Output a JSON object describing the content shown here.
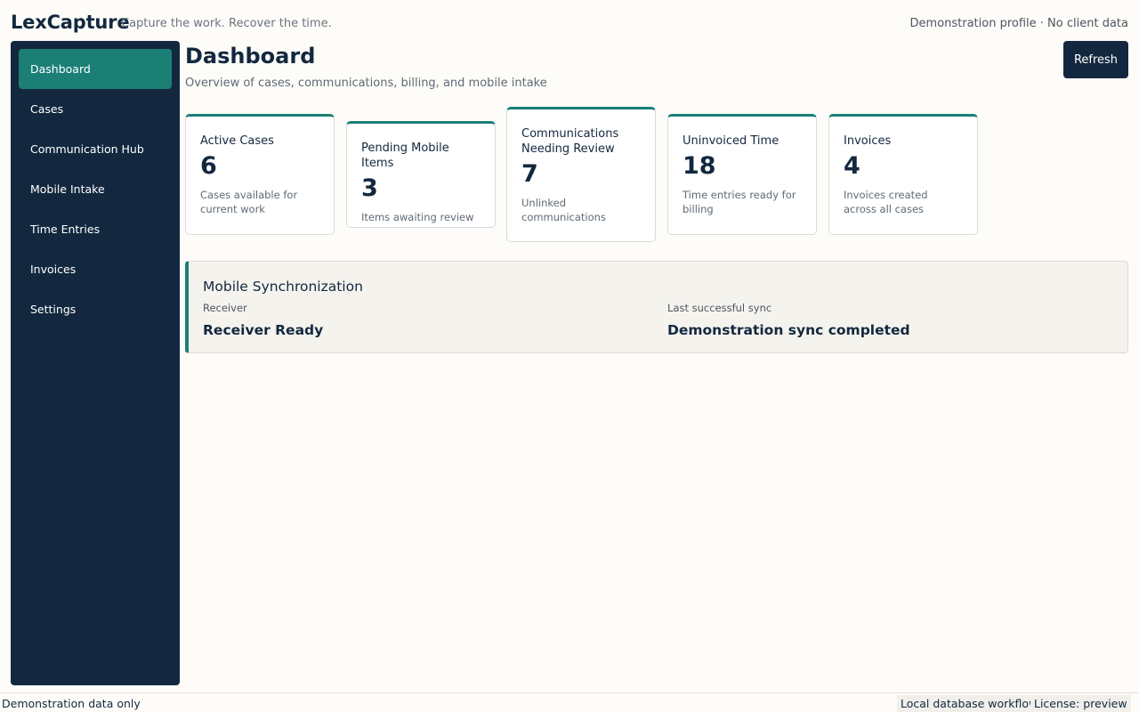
{
  "header": {
    "brand": "LexCapture",
    "tagline": "Capture the work. Recover the time.",
    "profile_note": "Demonstration profile · No client data"
  },
  "sidebar": {
    "items": [
      {
        "label": "Dashboard",
        "active": true
      },
      {
        "label": "Cases",
        "active": false
      },
      {
        "label": "Communication Hub",
        "active": false
      },
      {
        "label": "Mobile Intake",
        "active": false
      },
      {
        "label": "Time Entries",
        "active": false
      },
      {
        "label": "Invoices",
        "active": false
      },
      {
        "label": "Settings",
        "active": false
      }
    ]
  },
  "main": {
    "title": "Dashboard",
    "subtitle": "Overview of cases, communications, billing, and mobile intake",
    "refresh_label": "Refresh",
    "cards": [
      {
        "title": "Active Cases",
        "value": "6",
        "description": "Cases available for current work"
      },
      {
        "title": "Pending Mobile Items",
        "value": "3",
        "description": "Items awaiting review"
      },
      {
        "title": "Communications Needing Review",
        "value": "7",
        "description": "Unlinked communications"
      },
      {
        "title": "Uninvoiced Time",
        "value": "18",
        "description": "Time entries ready for billing"
      },
      {
        "title": "Invoices",
        "value": "4",
        "description": "Invoices created across all cases"
      }
    ],
    "sync": {
      "title": "Mobile Synchronization",
      "receiver_label": "Receiver",
      "receiver_value": "Receiver Ready",
      "last_sync_label": "Last successful sync",
      "last_sync_value": "Demonstration sync completed"
    }
  },
  "status_bar": {
    "left": "Demonstration data only",
    "database": "Local database workflow",
    "license": "License: preview"
  },
  "colors": {
    "navy": "#13283f",
    "teal": "#1b7f76",
    "background": "#fdfcf8"
  }
}
